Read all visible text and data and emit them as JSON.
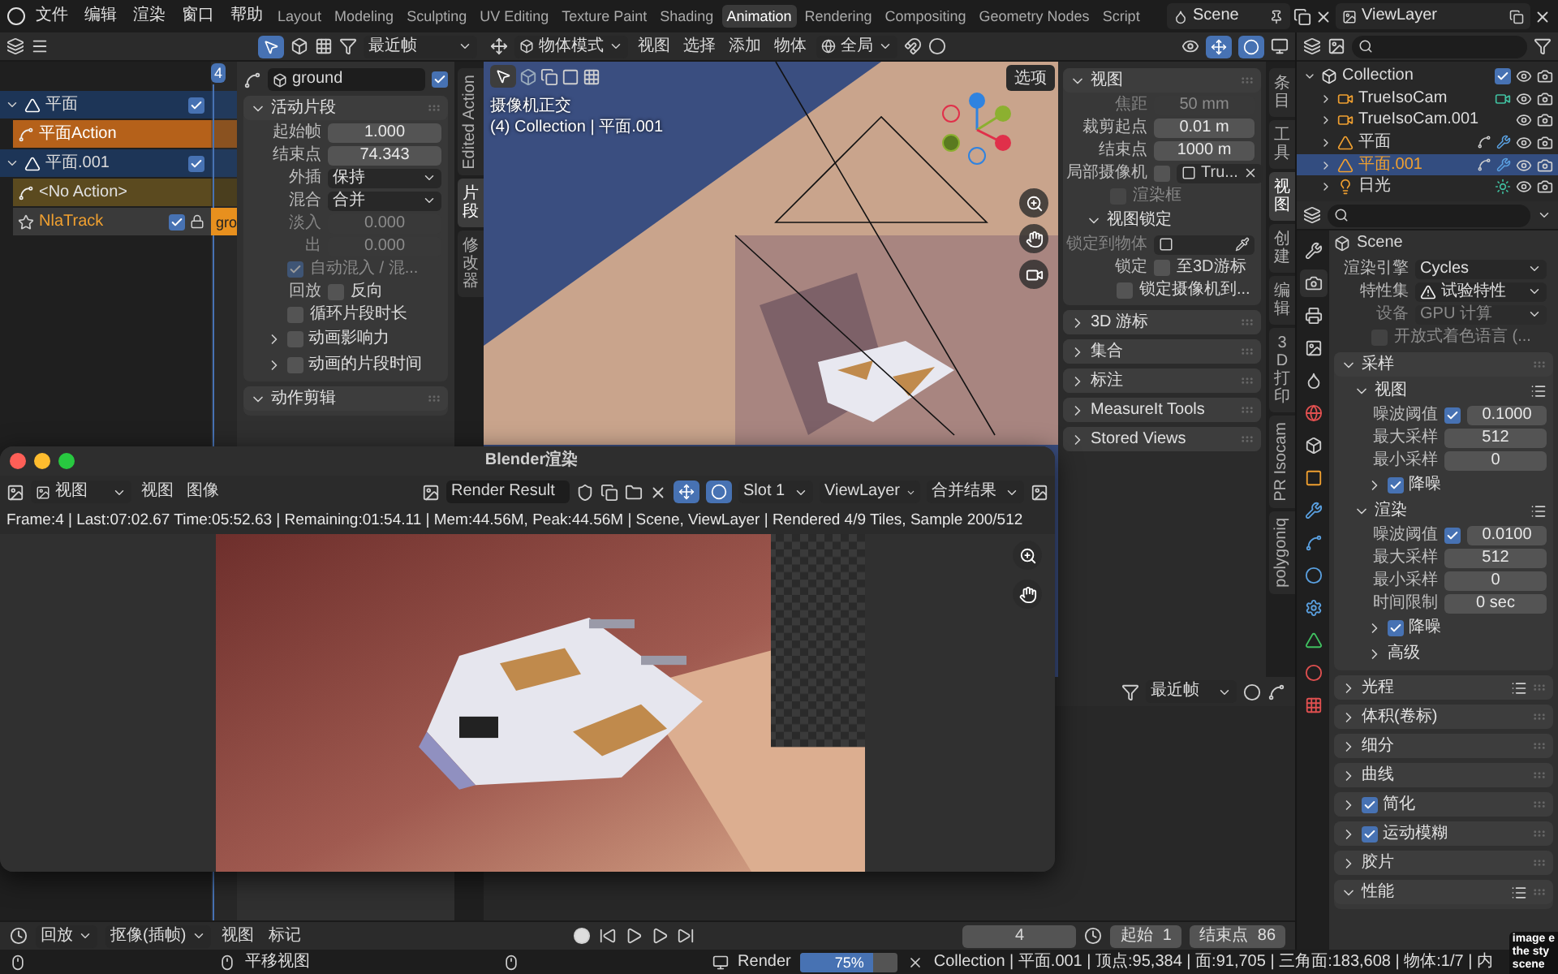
{
  "menu": [
    "文件",
    "编辑",
    "渲染",
    "窗口",
    "帮助"
  ],
  "workspaces": [
    {
      "label": "Layout",
      "selected": false
    },
    {
      "label": "Modeling",
      "selected": false
    },
    {
      "label": "Sculpting",
      "selected": false
    },
    {
      "label": "UV Editing",
      "selected": false
    },
    {
      "label": "Texture Paint",
      "selected": false
    },
    {
      "label": "Shading",
      "selected": false
    },
    {
      "label": "Animation",
      "selected": true
    },
    {
      "label": "Rendering",
      "selected": false
    },
    {
      "label": "Compositing",
      "selected": false
    },
    {
      "label": "Geometry Nodes",
      "selected": false
    },
    {
      "label": "Script",
      "selected": false
    }
  ],
  "scene": "Scene",
  "view_layer": "ViewLayer",
  "nla": {
    "frame_filter": "最近帧",
    "current_frame": "4",
    "strip_label": "gro",
    "channels": [
      {
        "kind": "object",
        "label": "平面",
        "checked": true
      },
      {
        "kind": "action",
        "label": "平面Action"
      },
      {
        "kind": "object",
        "label": "平面.001",
        "checked": true
      },
      {
        "kind": "empty_action",
        "label": "<No Action>"
      },
      {
        "kind": "track",
        "label": "NlaTrack",
        "checked": true
      }
    ],
    "sidebar": {
      "strip_name": "ground",
      "strip_enabled": true,
      "sections": [
        {
          "label": "活动片段",
          "kind": "plain",
          "expanded": true,
          "preset": false,
          "rows": [
            {
              "kind": "number",
              "label": "起始帧",
              "value": "1.000",
              "disabled": false
            },
            {
              "kind": "number",
              "label": "结束点",
              "value": "74.343",
              "disabled": false
            },
            {
              "kind": "select",
              "label": "外插",
              "value": "保持",
              "disabled": false
            },
            {
              "kind": "select",
              "label": "混合",
              "value": "合并",
              "disabled": false
            },
            {
              "kind": "number",
              "label": "淡入",
              "value": "0.000",
              "disabled": true
            },
            {
              "kind": "number",
              "label": "出",
              "value": "0.000",
              "disabled": true
            },
            {
              "kind": "check",
              "text": "自动混入 / 混...",
              "checked": true,
              "disabled": true
            },
            {
              "kind": "check",
              "label": "回放",
              "text": "反向",
              "checked": false,
              "disabled": false
            },
            {
              "kind": "check",
              "text": "循环片段时长",
              "checked": false,
              "disabled": false
            }
          ],
          "children": [
            {
              "label": "动画影响力",
              "kind": "toggle",
              "checked": false,
              "expanded": false,
              "preset": false
            },
            {
              "label": "动画的片段时间",
              "kind": "toggle",
              "checked": false,
              "expanded": false,
              "preset": false
            }
          ]
        },
        {
          "label": "动作剪辑",
          "kind": "plain",
          "expanded": true,
          "preset": false
        }
      ]
    },
    "tabs": [
      {
        "label": "Edited Action",
        "selected": false
      },
      {
        "label": "片段",
        "selected": true
      },
      {
        "label": "修改器",
        "selected": false
      }
    ]
  },
  "viewport": {
    "mode": "物体模式",
    "menus": [
      "视图",
      "选择",
      "添加",
      "物体"
    ],
    "orientation": "全局",
    "options": "选项",
    "overlay": [
      "摄像机正交",
      "(4) Collection | 平面.001"
    ],
    "sections": [
      {
        "label": "视图",
        "kind": "plain",
        "expanded": true,
        "preset": false,
        "rows": [
          {
            "kind": "number",
            "label": "焦距",
            "value": "50 mm",
            "disabled": true
          },
          {
            "kind": "number",
            "label": "裁剪起点",
            "value": "0.01 m",
            "disabled": false
          },
          {
            "kind": "number",
            "label": "结束点",
            "value": "1000 m",
            "disabled": false
          },
          {
            "kind": "camera",
            "label": "局部摄像机",
            "value": "Tru...",
            "checked": false,
            "disabled": false
          },
          {
            "kind": "check",
            "text": "渲染框",
            "checked": false,
            "disabled": true
          }
        ],
        "children": [
          {
            "label": "视图锁定",
            "kind": "plain",
            "expanded": true,
            "preset": false,
            "rows": [
              {
                "kind": "object",
                "label": "锁定到物体",
                "disabled": true
              },
              {
                "kind": "check",
                "label": "锁定",
                "text": "至3D游标",
                "checked": false,
                "disabled": false
              },
              {
                "kind": "check",
                "text": "锁定摄像机到...",
                "checked": false,
                "disabled": false
              }
            ]
          }
        ]
      },
      {
        "label": "3D 游标",
        "kind": "plain",
        "expanded": false,
        "preset": false
      },
      {
        "label": "集合",
        "kind": "plain",
        "expanded": false,
        "preset": false
      },
      {
        "label": "标注",
        "kind": "plain",
        "expanded": false,
        "preset": false
      },
      {
        "label": "MeasureIt Tools",
        "kind": "plain",
        "expanded": false,
        "preset": false
      },
      {
        "label": "Stored Views",
        "kind": "plain",
        "expanded": false,
        "preset": false
      }
    ],
    "tabs": [
      {
        "label": "条目",
        "selected": false
      },
      {
        "label": "工具",
        "selected": false
      },
      {
        "label": "视图",
        "selected": true
      },
      {
        "label": "创建",
        "selected": false
      },
      {
        "label": "编辑",
        "selected": false
      },
      {
        "label": "3D 打印",
        "selected": false
      },
      {
        "label": "PR Isocam",
        "selected": false
      },
      {
        "label": "polygoniq",
        "selected": false
      }
    ],
    "timeline_filter": "最近帧"
  },
  "outliner": {
    "tree": [
      {
        "label": "Collection",
        "kind": "collection",
        "expanded": true,
        "checked": true,
        "selected": false,
        "children": [
          {
            "label": "TrueIsoCam",
            "kind": "camera",
            "expanded": false,
            "selected": false
          },
          {
            "label": "TrueIsoCam.001",
            "kind": "camera_plain",
            "expanded": false,
            "selected": false
          },
          {
            "label": "平面",
            "kind": "mesh",
            "expanded": false,
            "selected": false
          },
          {
            "label": "平面.001",
            "kind": "mesh",
            "expanded": false,
            "selected": true
          },
          {
            "label": "日光",
            "kind": "light",
            "expanded": false,
            "selected": false
          }
        ]
      }
    ]
  },
  "properties": {
    "scene": "Scene",
    "tabs": [
      {
        "selected": false
      },
      {
        "selected": true
      },
      {
        "selected": false
      },
      {
        "selected": false
      },
      {
        "selected": false
      },
      {
        "selected": false
      },
      {
        "selected": false
      },
      {
        "selected": false
      },
      {
        "selected": false
      },
      {
        "selected": false
      },
      {
        "selected": false
      },
      {
        "selected": false
      },
      {
        "selected": false
      },
      {
        "selected": false
      },
      {
        "selected": false
      }
    ],
    "rows": [
      {
        "kind": "select",
        "label": "渲染引擎",
        "value": "Cycles",
        "disabled": false,
        "warning": false
      },
      {
        "kind": "select",
        "label": "特性集",
        "value": "试验特性",
        "disabled": false,
        "warning": true
      },
      {
        "kind": "select",
        "label": "设备",
        "value": "GPU 计算",
        "disabled": true,
        "warning": false
      },
      {
        "kind": "check",
        "text": "开放式着色语言 (...",
        "checked": false,
        "disabled": true
      }
    ],
    "sections": [
      {
        "label": "采样",
        "kind": "plain",
        "expanded": true,
        "preset": false,
        "children": [
          {
            "label": "视图",
            "kind": "plain",
            "expanded": true,
            "preset": true,
            "rows": [
              {
                "kind": "checknum",
                "label": "噪波阈值",
                "checked": true,
                "value": "0.1000",
                "disabled": false
              },
              {
                "kind": "number",
                "label": "最大采样",
                "value": "512",
                "disabled": false
              },
              {
                "kind": "number",
                "label": "最小采样",
                "value": "0",
                "disabled": false
              }
            ],
            "children": [
              {
                "label": "降噪",
                "kind": "toggle",
                "checked": true,
                "expanded": false,
                "preset": false
              }
            ]
          },
          {
            "label": "渲染",
            "kind": "plain",
            "expanded": true,
            "preset": true,
            "rows": [
              {
                "kind": "checknum",
                "label": "噪波阈值",
                "checked": true,
                "value": "0.0100",
                "disabled": false
              },
              {
                "kind": "number",
                "label": "最大采样",
                "value": "512",
                "disabled": false
              },
              {
                "kind": "number",
                "label": "最小采样",
                "value": "0",
                "disabled": false
              },
              {
                "kind": "number",
                "label": "时间限制",
                "value": "0 sec",
                "disabled": false
              }
            ],
            "children": [
              {
                "label": "降噪",
                "kind": "toggle",
                "checked": true,
                "expanded": false,
                "preset": false
              },
              {
                "label": "高级",
                "kind": "plain",
                "expanded": false,
                "preset": false
              }
            ]
          }
        ]
      },
      {
        "label": "光程",
        "kind": "plain",
        "expanded": false,
        "preset": true
      },
      {
        "label": "体积(卷标)",
        "kind": "plain",
        "expanded": false,
        "preset": false
      },
      {
        "label": "细分",
        "kind": "plain",
        "expanded": false,
        "preset": false
      },
      {
        "label": "曲线",
        "kind": "plain",
        "expanded": false,
        "preset": false
      },
      {
        "label": "简化",
        "kind": "toggle",
        "checked": true,
        "expanded": false,
        "preset": false
      },
      {
        "label": "运动模糊",
        "kind": "toggle",
        "checked": true,
        "expanded": false,
        "preset": false
      },
      {
        "label": "胶片",
        "kind": "plain",
        "expanded": false,
        "preset": false
      },
      {
        "label": "性能",
        "kind": "plain",
        "expanded": true,
        "preset": true
      }
    ]
  },
  "render_window": {
    "title": "Blender渲染",
    "view_select": "视图",
    "menus": [
      "视图",
      "图像"
    ],
    "image": "Render Result",
    "slot": "Slot 1",
    "layer": "ViewLayer",
    "pass": "合并结果",
    "info": "Frame:4 | Last:07:02.67 Time:05:52.63 | Remaining:01:54.11 | Mem:44.56M, Peak:44.56M | Scene, ViewLayer | Rendered 4/9 Tiles, Sample 200/512"
  },
  "timeline": {
    "playback": "回放",
    "keying": "抠像(插帧)",
    "menus": [
      "视图",
      "标记"
    ],
    "current": "4",
    "start_label": "起始",
    "start": "1",
    "end_label": "结束点",
    "end": "86"
  },
  "status": {
    "hint": "平移视图",
    "render_label": "Render",
    "progress": {
      "level": 0.75,
      "text": "75%"
    },
    "stats": "Collection | 平面.001 | 顶点:95,384 | 面:91,705 | 三角面:183,608 | 物体:1/7 | 内"
  },
  "tooltip": [
    "image e",
    "the sty",
    "scene"
  ]
}
